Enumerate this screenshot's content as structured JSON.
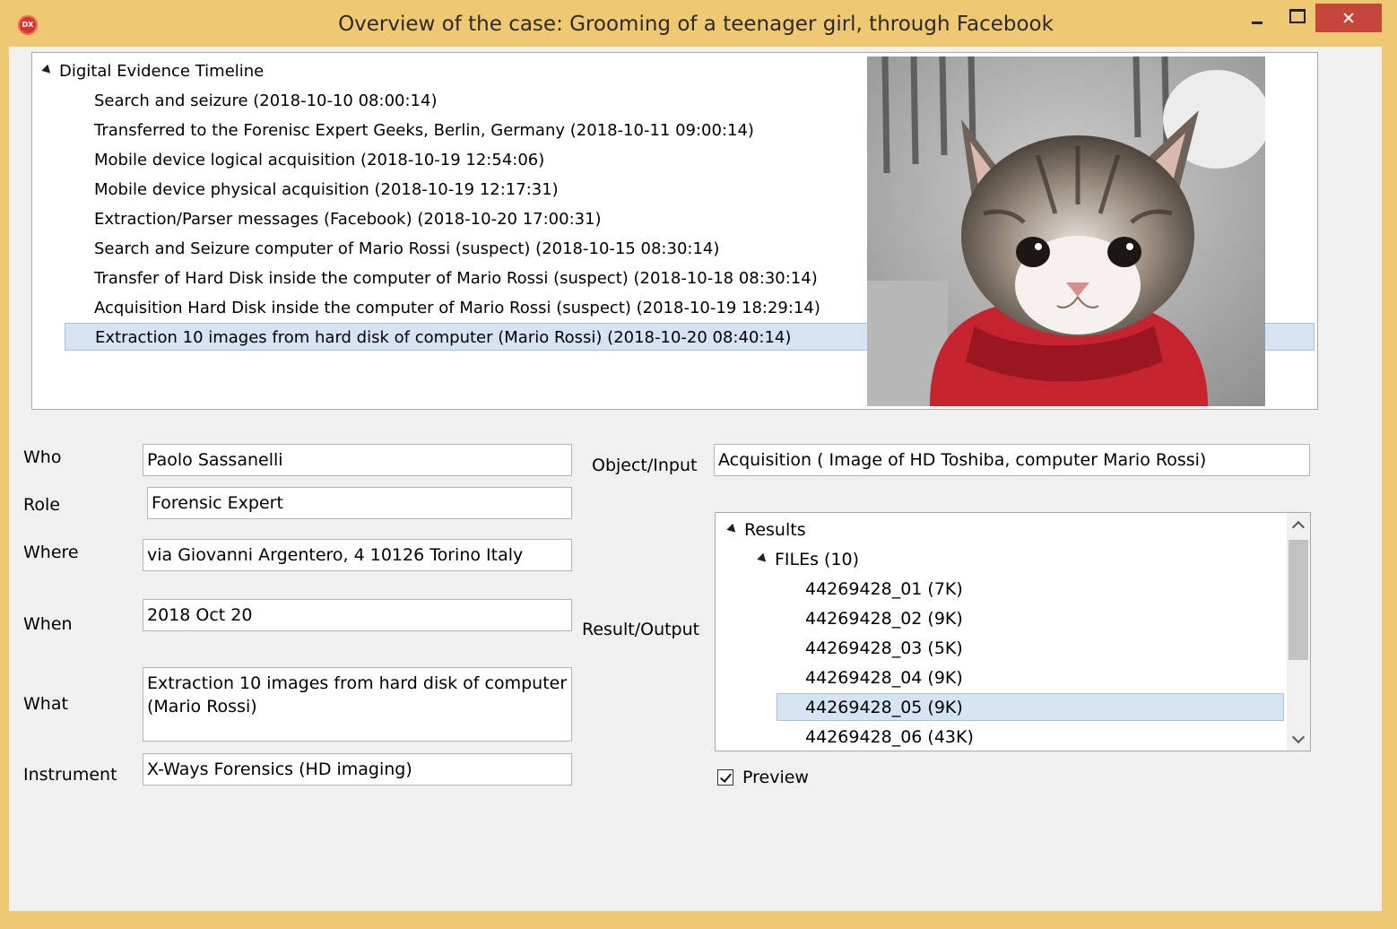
{
  "window": {
    "app_icon_text": "DX",
    "title": "Overview of the case: Grooming of a teenager girl, through Facebook"
  },
  "timeline": {
    "root_label": "Digital Evidence Timeline",
    "items": [
      "Search and seizure (2018-10-10 08:00:14)",
      "Transferred to the Forenisc Expert Geeks, Berlin, Germany (2018-10-11 09:00:14)",
      "Mobile device logical acquisition (2018-10-19 12:54:06)",
      "Mobile device physical acquisition (2018-10-19 12:17:31)",
      "Extraction/Parser messages (Facebook) (2018-10-20 17:00:31)",
      "Search and Seizure computer of Mario Rossi (suspect) (2018-10-15 08:30:14)",
      "Transfer of Hard Disk inside the computer of Mario Rossi (suspect) (2018-10-18 08:30:14)",
      "Acquisition Hard Disk inside the computer of Mario Rossi (suspect) (2018-10-19 18:29:14)",
      "Extraction 10 images from hard disk of computer (Mario Rossi) (2018-10-20 08:40:14)"
    ],
    "selected_index": 8
  },
  "form": {
    "who_label": "Who",
    "who_value": "Paolo Sassanelli",
    "role_label": "Role",
    "role_value": "Forensic Expert",
    "where_label": "Where",
    "where_value": "via Giovanni Argentero, 4 10126 Torino Italy",
    "when_label": "When",
    "when_value": "2018 Oct 20",
    "what_label": "What",
    "what_value": "Extraction 10 images from hard disk of computer (Mario Rossi)",
    "instrument_label": "Instrument",
    "instrument_value": "X-Ways Forensics (HD imaging)",
    "object_label": "Object/Input",
    "object_value": "Acquisition ( Image of HD Toshiba, computer Mario Rossi)",
    "result_label": "Result/Output"
  },
  "results": {
    "root_label": "Results",
    "folder_label": "FILEs (10)",
    "files": [
      "44269428_01 (7K)",
      "44269428_02 (9K)",
      "44269428_03 (5K)",
      "44269428_04 (9K)",
      "44269428_05 (9K)",
      "44269428_06 (43K)"
    ],
    "selected_index": 4
  },
  "preview": {
    "label": "Preview",
    "checked": true
  },
  "colors": {
    "title_bar": "#efc873",
    "close_button": "#c7463a",
    "selection": "#d6e3f3",
    "selection_border": "#a7c2e4"
  }
}
